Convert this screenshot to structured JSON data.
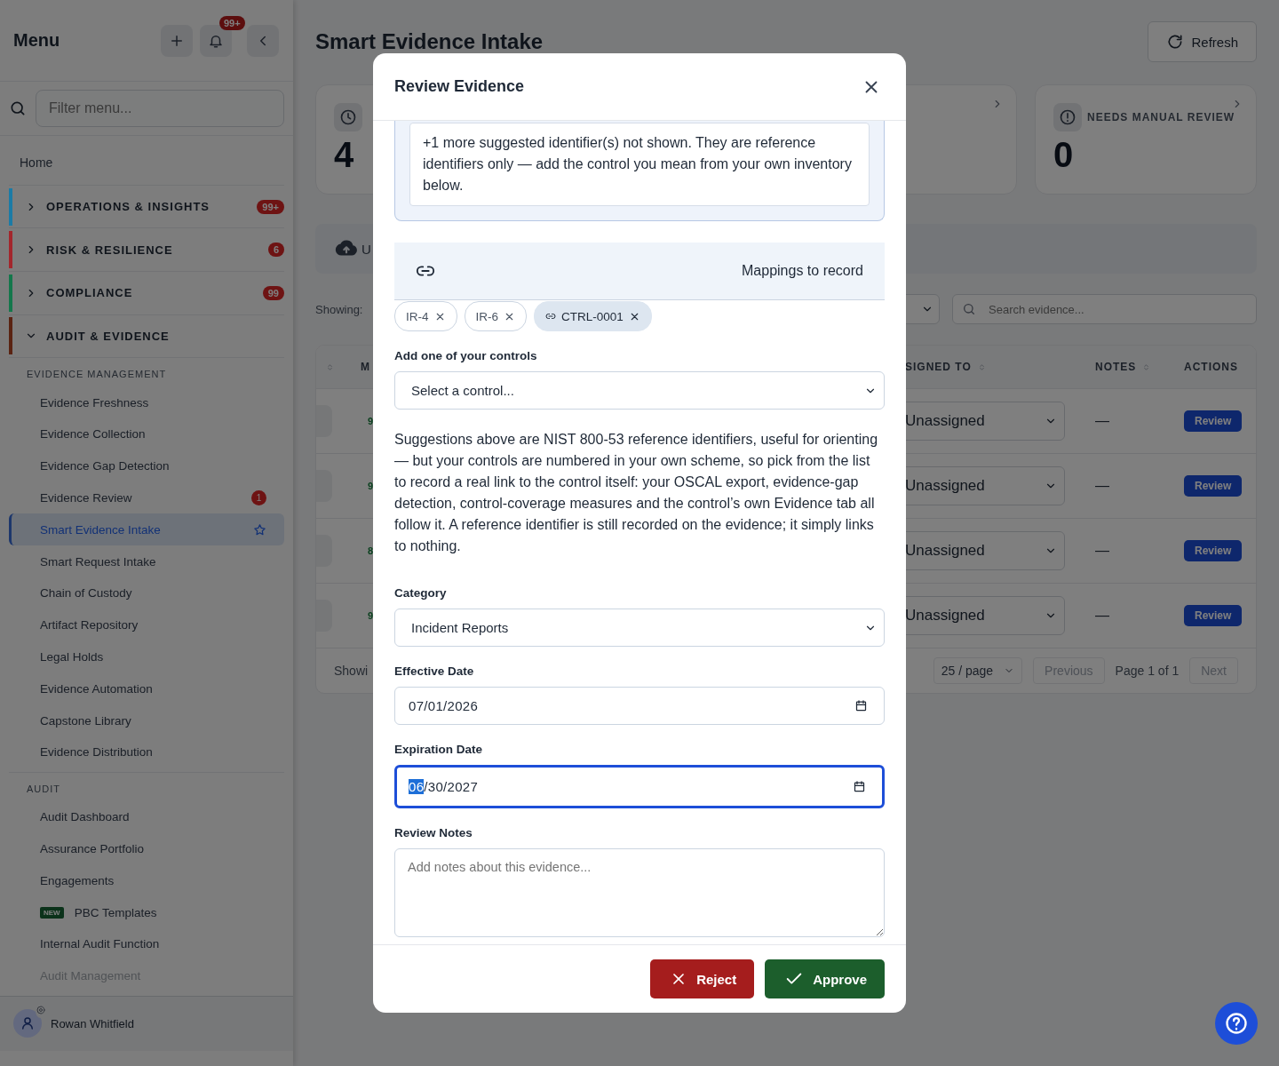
{
  "sidebar": {
    "title": "Menu",
    "notification_count": "99+",
    "filter": {
      "placeholder": "Filter menu..."
    },
    "home": "Home",
    "groups": [
      {
        "label": "OPERATIONS & INSIGHTS",
        "color": "#1b7ba6",
        "badge": "99+",
        "expanded": false
      },
      {
        "label": "RISK & RESILIENCE",
        "color": "#a3262c",
        "badge": "6",
        "expanded": false
      },
      {
        "label": "COMPLIANCE",
        "color": "#14774b",
        "badge": "99",
        "expanded": false
      },
      {
        "label": "AUDIT & EVIDENCE",
        "color": "#5a2312",
        "expanded": true,
        "sections": [
          {
            "heading": "EVIDENCE MANAGEMENT",
            "items": [
              {
                "label": "Evidence Freshness",
                "selected": false,
                "disabled": false
              },
              {
                "label": "Evidence Collection",
                "selected": false,
                "disabled": false
              },
              {
                "label": "Evidence Gap Detection",
                "selected": false,
                "disabled": false
              },
              {
                "label": "Evidence Review",
                "selected": false,
                "disabled": false,
                "badge": "1"
              },
              {
                "label": "Smart Evidence Intake",
                "selected": true,
                "disabled": false
              },
              {
                "label": "Smart Request Intake",
                "selected": false,
                "disabled": false
              },
              {
                "label": "Chain of Custody",
                "selected": false,
                "disabled": false
              },
              {
                "label": "Artifact Repository",
                "selected": false,
                "disabled": false
              },
              {
                "label": "Legal Holds",
                "selected": false,
                "disabled": false
              },
              {
                "label": "Evidence Automation",
                "selected": false,
                "disabled": false
              },
              {
                "label": "Capstone Library",
                "selected": false,
                "disabled": false
              },
              {
                "label": "Evidence Distribution",
                "selected": false,
                "disabled": false
              }
            ]
          },
          {
            "heading": "AUDIT",
            "items": [
              {
                "label": "Audit Dashboard",
                "selected": false,
                "disabled": false
              },
              {
                "label": "Assurance Portfolio",
                "selected": false,
                "disabled": false
              },
              {
                "label": "Engagements",
                "selected": false,
                "disabled": false
              },
              {
                "label": "PBC Templates",
                "selected": false,
                "disabled": false,
                "tag": "NEW"
              },
              {
                "label": "Internal Audit Function",
                "selected": false,
                "disabled": false
              },
              {
                "label": "Audit Management",
                "selected": false,
                "disabled": true
              }
            ]
          }
        ]
      }
    ],
    "user": {
      "name": "Rowan Whitfield"
    }
  },
  "main": {
    "title": "Smart Evidence Intake",
    "refresh": "Refresh",
    "stat_cards": [
      {
        "value": "4"
      },
      {
        "label": "NEEDS MANUAL REVIEW",
        "value": "0"
      }
    ],
    "upload_label": "U",
    "showing_label": "Showing:",
    "search": {
      "placeholder": "Search evidence..."
    },
    "table": {
      "columns": [
        {
          "label": "M",
          "sortable": false
        },
        {
          "label": "SIGNED TO",
          "sortable": true
        },
        {
          "label": "NOTES",
          "sortable": true
        },
        {
          "label": "ACTIONS",
          "sortable": false
        }
      ],
      "rows": [
        {
          "score": "9",
          "assignee": "Unassigned",
          "notes": "—",
          "action": "Review"
        },
        {
          "score": "9",
          "assignee": "Unassigned",
          "notes": "—",
          "action": "Review"
        },
        {
          "score": "8",
          "assignee": "Unassigned",
          "notes": "—",
          "action": "Review"
        },
        {
          "score": "9",
          "assignee": "Unassigned",
          "notes": "—",
          "action": "Review"
        }
      ]
    },
    "pagination": {
      "summary": "Showi",
      "page_size": "25 / page",
      "previous": {
        "label": "Previous",
        "disabled": true
      },
      "page": "Page 1 of 1",
      "next": {
        "label": "Next",
        "disabled": true
      }
    }
  },
  "modal": {
    "title": "Review Evidence",
    "notice": "+1 more suggested identifier(s) not shown. They are reference identifiers only — add the control you mean from your own inventory below.",
    "mappings": {
      "title": "Mappings to record",
      "chips": [
        {
          "label": "IR-4",
          "kind": "reference"
        },
        {
          "label": "IR-6",
          "kind": "reference"
        },
        {
          "label": "CTRL-0001",
          "kind": "control"
        }
      ]
    },
    "fields": [
      {
        "kind": "select",
        "label": "Add one of your controls",
        "value": "Select a control...",
        "focused": false
      },
      {
        "kind": "paragraph",
        "text": "Suggestions above are NIST 800-53 reference identifiers, useful for orienting — but your controls are numbered in your own scheme, so pick from the list to record a real link to the control itself: your OSCAL export, evidence-gap detection, control-coverage measures and the control’s own Evidence tab all follow it. A reference identifier is still recorded on the evidence; it simply links to nothing."
      },
      {
        "kind": "select",
        "label": "Category",
        "value": "Incident Reports",
        "focused": false
      },
      {
        "kind": "date",
        "label": "Effective Date",
        "value": "07/01/2026",
        "focused": false
      },
      {
        "kind": "date",
        "label": "Expiration Date",
        "value": "06/30/2027",
        "focused": true
      },
      {
        "kind": "textarea",
        "label": "Review Notes",
        "placeholder": "Add notes about this evidence...",
        "focused": false
      }
    ],
    "buttons": [
      {
        "label": "Reject",
        "kind": "danger"
      },
      {
        "label": "Approve",
        "kind": "success"
      }
    ]
  }
}
